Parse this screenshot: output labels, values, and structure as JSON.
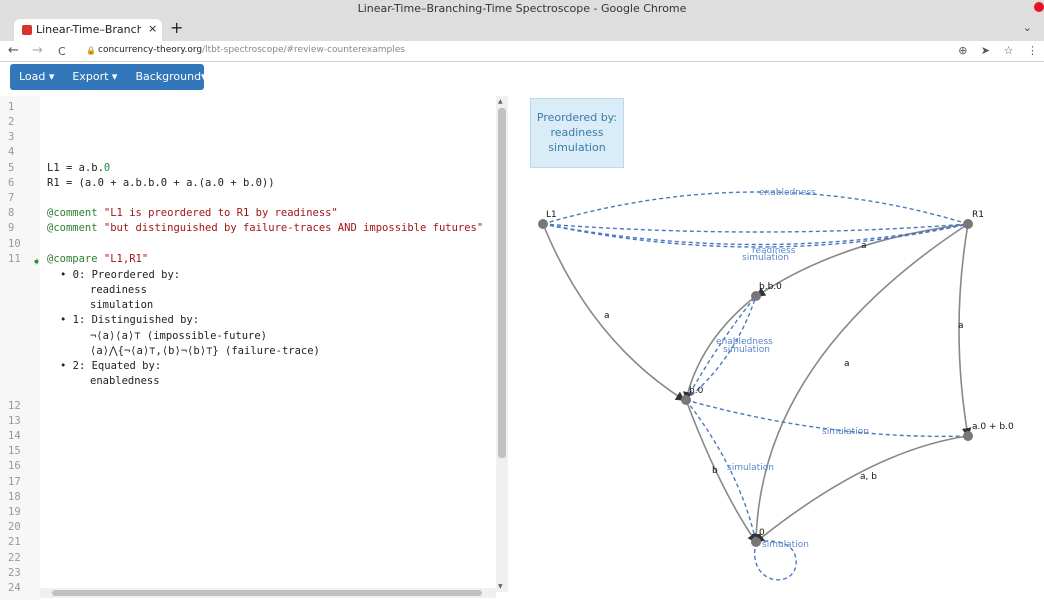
{
  "window": {
    "title": "Linear-Time–Branching-Time Spectroscope - Google Chrome"
  },
  "tab": {
    "label": "Linear-Time–Branching-",
    "close": "×"
  },
  "newtab": "+",
  "tabchev": "⌄",
  "address": {
    "host": "concurrency-theory.org",
    "path": "/ltbt-spectroscope/#review-counterexamples"
  },
  "nav": {
    "back": "←",
    "forward": "→",
    "reload": "C"
  },
  "actions": {
    "zoom": "⊕",
    "send": "➤",
    "star": "☆",
    "menu": "⋮"
  },
  "toolbar": {
    "load": "Load ▾",
    "export": "Export ▾",
    "background": "Background▾"
  },
  "editor": {
    "line_numbers": [
      "1",
      "2",
      "3",
      "4",
      "5",
      "6",
      "7",
      "8",
      "9",
      "10",
      "11",
      "12",
      "13",
      "14",
      "15",
      "16",
      "17",
      "18",
      "19",
      "20",
      "21",
      "22",
      "23",
      "24"
    ],
    "l1_name": "L1 = a.b.",
    "l1_zero": "0",
    "r1": "R1 = (a.0 + a.b.b.0 + a.(a.0 + b.0))",
    "comment1_kw": "@comment",
    "comment1_str": "\"L1 is preordered to R1 by readiness\"",
    "comment2_kw": "@comment",
    "comment2_str": "\"but distinguished by failure-traces AND impossible futures\"",
    "compare_kw": "@compare",
    "compare_str": "\"L1,R1\"",
    "r0": "• 0: Preordered by:",
    "r0a": "readiness",
    "r0b": "simulation",
    "r1h": "• 1: Distinguished by:",
    "r1a": "¬⟨a⟩⟨a⟩⊤ (impossible-future)",
    "r1b": "⟨a⟩⋀{¬⟨a⟩⊤,⟨b⟩¬⟨b⟩⊤} (failure-trace)",
    "r2h": "• 2: Equated by:",
    "r2a": "enabledness"
  },
  "infobox": {
    "line1": "Preordered by:",
    "line2": "readiness",
    "line3": "simulation"
  },
  "graph": {
    "nodes": {
      "L1": "L1",
      "R1": "R1",
      "bb0": "b.b.0",
      "b0": "b.0",
      "a0b0": "a.0 + b.0",
      "zero": "0"
    },
    "edges": {
      "a1": "a",
      "a2": "a",
      "a3": "a",
      "a4": "a",
      "b": "b",
      "ab": "a, b",
      "enabled_top": "enabledness",
      "readiness_top": "readiness",
      "simulation_top": "simulation",
      "enabled_mid": "enabledness",
      "simulation_mid": "simulation",
      "simulation_right": "simulation",
      "simulation_down": "simulation",
      "simulation_loop": "simulation"
    }
  },
  "colors": {
    "accent": "#3377bb",
    "edge": "#888888",
    "dashed": "#4a78c0",
    "node": "#777777"
  }
}
